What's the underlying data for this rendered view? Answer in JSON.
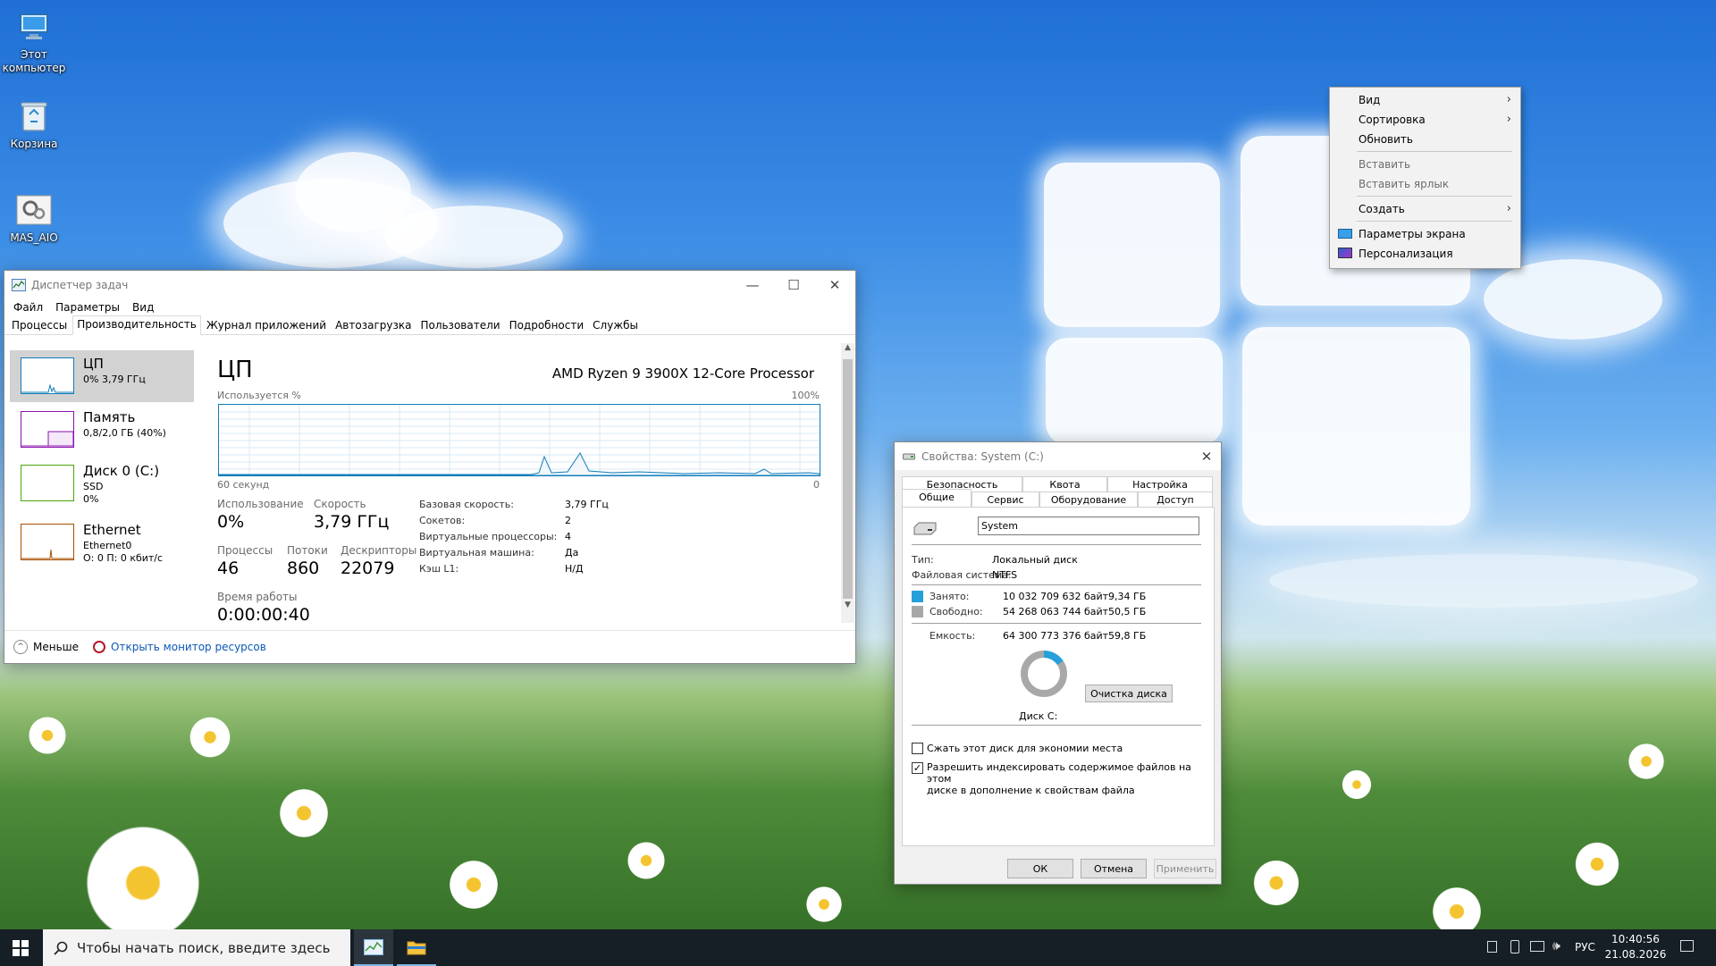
{
  "desktop": {
    "icons": [
      {
        "label": "Этот компьютер"
      },
      {
        "label": "Корзина"
      },
      {
        "label": "MAS_AIO"
      }
    ]
  },
  "task_manager": {
    "title": "Диспетчер задач",
    "menu": [
      "Файл",
      "Параметры",
      "Вид"
    ],
    "tabs": [
      "Процессы",
      "Производительность",
      "Журнал приложений",
      "Автозагрузка",
      "Пользователи",
      "Подробности",
      "Службы"
    ],
    "active_tab": "Производительность",
    "sidebar": [
      {
        "title": "ЦП",
        "sub1": "0% 3,79 ГГц",
        "sub2": "",
        "sub3": ""
      },
      {
        "title": "Память",
        "sub1": "0,8/2,0 ГБ (40%)",
        "sub2": "",
        "sub3": ""
      },
      {
        "title": "Диск 0 (C:)",
        "sub1": "SSD",
        "sub2": "0%",
        "sub3": ""
      },
      {
        "title": "Ethernet",
        "sub1": "Ethernet0",
        "sub2": "О: 0 П: 0 кбит/с",
        "sub3": ""
      }
    ],
    "cpu": {
      "heading": "ЦП",
      "model": "AMD Ryzen 9 3900X 12-Core Processor",
      "graph_label": "Используется %",
      "graph_max": "100%",
      "graph_time": "60 секунд",
      "graph_min": "0",
      "usage_label": "Использование",
      "usage_value": "0%",
      "speed_label": "Скорость",
      "speed_value": "3,79 ГГц",
      "processes_label": "Процессы",
      "processes_value": "46",
      "threads_label": "Потоки",
      "threads_value": "860",
      "handles_label": "Дескрипторы",
      "handles_value": "22079",
      "uptime_label": "Время работы",
      "uptime_value": "0:00:00:40",
      "details": [
        {
          "k": "Базовая скорость:",
          "v": "3,79 ГГц"
        },
        {
          "k": "Сокетов:",
          "v": "2"
        },
        {
          "k": "Виртуальные процессоры:",
          "v": "4"
        },
        {
          "k": "Виртуальная машина:",
          "v": "Да"
        },
        {
          "k": "Кэш L1:",
          "v": "Н/Д"
        }
      ]
    },
    "footer": {
      "less": "Меньше",
      "monitor": "Открыть монитор ресурсов"
    }
  },
  "properties": {
    "title": "Свойства: System (C:)",
    "tabs_top": [
      "Безопасность",
      "Квота",
      "Настройка"
    ],
    "tabs_bottom": [
      "Общие",
      "Сервис",
      "Оборудование",
      "Доступ"
    ],
    "name_value": "System",
    "type_label": "Тип:",
    "type_value": "Локальный диск",
    "fs_label": "Файловая система:",
    "fs_value": "NTFS",
    "used_label": "Занято:",
    "used_bytes": "10 032 709 632 байт",
    "used_gb": "9,34 ГБ",
    "free_label": "Свободно:",
    "free_bytes": "54 268 063 744 байт",
    "free_gb": "50,5 ГБ",
    "capacity_label": "Емкость:",
    "capacity_bytes": "64 300 773 376 байт",
    "capacity_gb": "59,8 ГБ",
    "disk_label": "Диск C:",
    "cleanup_button": "Очистка диска",
    "compress_label": "Сжать этот диск для экономии места",
    "compress_checked": false,
    "index_label_1": "Разрешить индексировать содержимое файлов на этом",
    "index_label_2": "диске в дополнение к свойствам файла",
    "index_checked": true,
    "ok": "ОК",
    "cancel": "Отмена",
    "apply": "Применить",
    "used_fraction": 0.156,
    "colors": {
      "used": "#26a0da",
      "free": "#a8a8a8"
    }
  },
  "context_menu": {
    "items": [
      {
        "label": "Вид",
        "submenu": true,
        "disabled": false
      },
      {
        "label": "Сортировка",
        "submenu": true,
        "disabled": false
      },
      {
        "label": "Обновить",
        "submenu": false,
        "disabled": false
      },
      {
        "label": "Вставить",
        "submenu": false,
        "disabled": true
      },
      {
        "label": "Вставить ярлык",
        "submenu": false,
        "disabled": true
      },
      {
        "label": "Создать",
        "submenu": true,
        "disabled": false
      },
      {
        "label": "Параметры экрана",
        "submenu": false,
        "disabled": false
      },
      {
        "label": "Персонализация",
        "submenu": false,
        "disabled": false
      }
    ]
  },
  "taskbar": {
    "search_placeholder": "Чтобы начать поиск, введите здесь",
    "language": "РУС",
    "time": "10:40:56",
    "date": "21.08.2026"
  }
}
